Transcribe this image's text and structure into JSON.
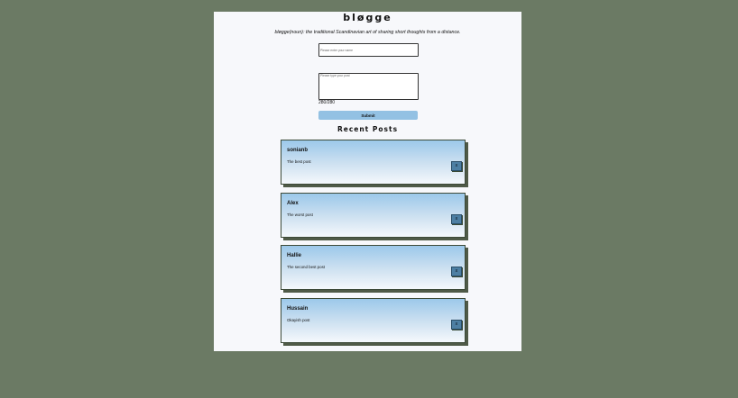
{
  "app": {
    "title": "bløgge",
    "tagline": "bløgge(noun): the traditional Scandinavian art of sharing short thoughts from a distance."
  },
  "form": {
    "name_placeholder": "Please enter your name",
    "post_placeholder": "Please type your post",
    "counter": "280/280",
    "submit_label": "Submit"
  },
  "recent_heading": "Recent Posts",
  "posts": [
    {
      "author": "sonianb",
      "text": "The best post",
      "delete_icon": "x"
    },
    {
      "author": "Alex",
      "text": "The worst post",
      "delete_icon": "x"
    },
    {
      "author": "Hallie",
      "text": "The second best post",
      "delete_icon": "x"
    },
    {
      "author": "Hussain",
      "text": "Okayish post",
      "delete_icon": "x"
    }
  ],
  "colors": {
    "background": "#6b7a64",
    "panel": "#f7f8fb",
    "submit": "#93c1e3",
    "delete_button": "#4d7fa3"
  }
}
